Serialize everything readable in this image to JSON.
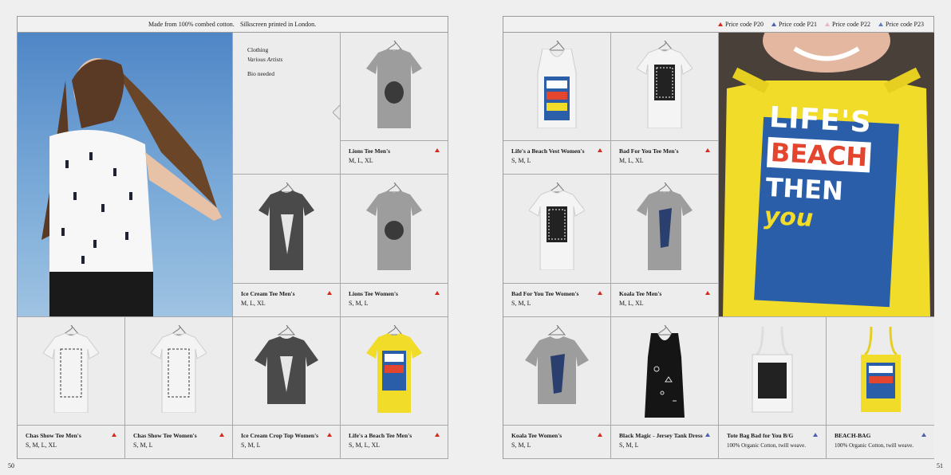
{
  "left_page": {
    "header_left": "Made from 100% combed cotton.",
    "header_right": "Silkscreen printed in London.",
    "info": {
      "line1": "Clothing",
      "line2": "Various Artists",
      "line3": "Bio needed"
    },
    "page_number": "50",
    "products": [
      {
        "name": "Lions Tee Men's",
        "sizes": "M, L, XL",
        "price_code": "red"
      },
      {
        "name": "Ice Cream Tee Men's",
        "sizes": "M, L, XL",
        "price_code": "red"
      },
      {
        "name": "Lions Tee Women's",
        "sizes": "S, M, L",
        "price_code": "red"
      },
      {
        "name": "Chas Show Tee Men's",
        "sizes": "S, M, L, XL",
        "price_code": "red"
      },
      {
        "name": "Chas Show Tee Women's",
        "sizes": "S, M, L",
        "price_code": "red"
      },
      {
        "name": "Ice Cream Crop Top Women's",
        "sizes": "S, M, L",
        "price_code": "red"
      },
      {
        "name": "Life's a Beach Tee Men's",
        "sizes": "S, M, L, XL",
        "price_code": "red"
      }
    ]
  },
  "right_page": {
    "legend": [
      {
        "label": "Price code P20",
        "color": "#d52b1e"
      },
      {
        "label": "Price code P21",
        "color": "#4a5fb0"
      },
      {
        "label": "Price code P22",
        "color": "#e8b7c3"
      },
      {
        "label": "Price code P23",
        "color": "#5d7fc2"
      }
    ],
    "page_number": "51",
    "products": [
      {
        "name": "Life's a Beach Vest Women's",
        "sizes": "S, M, L",
        "price_code": "red"
      },
      {
        "name": "Bad For You Tee Men's",
        "sizes": "M, L, XL",
        "price_code": "red"
      },
      {
        "name": "Bad For You Tee Women's",
        "sizes": "S, M, L",
        "price_code": "red"
      },
      {
        "name": "Koala Tee Men's",
        "sizes": "M, L, XL",
        "price_code": "red"
      },
      {
        "name": "Koala Tee Women's",
        "sizes": "S, M, L",
        "price_code": "red"
      },
      {
        "name": "Black Magic - Jersey Tank Dress",
        "sizes": "S, M, L",
        "price_code": "blue"
      },
      {
        "name": "Tote Bag Bad for You B/G",
        "sizes": "100% Organic Cotton, twill weave.",
        "price_code": "blue"
      },
      {
        "name": "BEACH-BAG",
        "sizes": "100% Organic Cotton, twill weave.",
        "price_code": "blue"
      }
    ],
    "bag_print": {
      "l1": "LIFE'S",
      "l2": "BEACH",
      "l3": "THEN",
      "l4": "you"
    }
  },
  "colors": {
    "grey_shirt": "#9d9d9d",
    "dark_shirt": "#4a4a4a",
    "white_shirt": "#f4f4f4",
    "yellow": "#f2dc2a",
    "sky": "#6f9fd0"
  }
}
